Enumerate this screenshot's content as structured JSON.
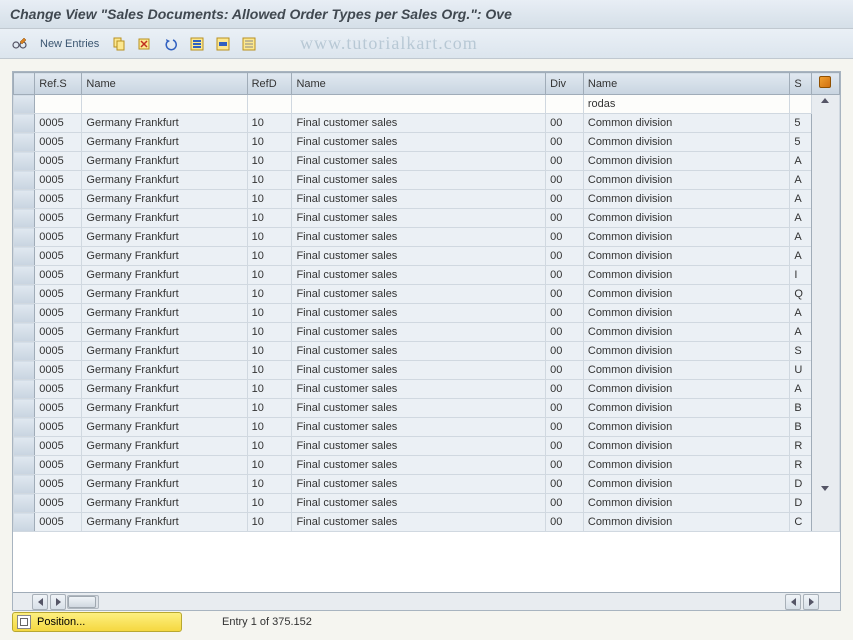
{
  "title": "Change View \"Sales Documents: Allowed Order Types per Sales Org.\": Ove",
  "watermark": "www.tutorialkart.com",
  "toolbar": {
    "new_entries": "New Entries"
  },
  "columns": {
    "refs": "Ref.S",
    "name1": "Name",
    "refd": "RefD",
    "name2": "Name",
    "div": "Div",
    "name3": "Name",
    "s": "S"
  },
  "rows": [
    {
      "refs": "",
      "name1": "",
      "refd": "",
      "name2": "",
      "div": "",
      "name3": "rodas",
      "s": ""
    },
    {
      "refs": "0005",
      "name1": "Germany Frankfurt",
      "refd": "10",
      "name2": "Final customer sales",
      "div": "00",
      "name3": "Common division",
      "s": "5"
    },
    {
      "refs": "0005",
      "name1": "Germany Frankfurt",
      "refd": "10",
      "name2": "Final customer sales",
      "div": "00",
      "name3": "Common division",
      "s": "5"
    },
    {
      "refs": "0005",
      "name1": "Germany Frankfurt",
      "refd": "10",
      "name2": "Final customer sales",
      "div": "00",
      "name3": "Common division",
      "s": "A"
    },
    {
      "refs": "0005",
      "name1": "Germany Frankfurt",
      "refd": "10",
      "name2": "Final customer sales",
      "div": "00",
      "name3": "Common division",
      "s": "A"
    },
    {
      "refs": "0005",
      "name1": "Germany Frankfurt",
      "refd": "10",
      "name2": "Final customer sales",
      "div": "00",
      "name3": "Common division",
      "s": "A"
    },
    {
      "refs": "0005",
      "name1": "Germany Frankfurt",
      "refd": "10",
      "name2": "Final customer sales",
      "div": "00",
      "name3": "Common division",
      "s": "A"
    },
    {
      "refs": "0005",
      "name1": "Germany Frankfurt",
      "refd": "10",
      "name2": "Final customer sales",
      "div": "00",
      "name3": "Common division",
      "s": "A"
    },
    {
      "refs": "0005",
      "name1": "Germany Frankfurt",
      "refd": "10",
      "name2": "Final customer sales",
      "div": "00",
      "name3": "Common division",
      "s": "A"
    },
    {
      "refs": "0005",
      "name1": "Germany Frankfurt",
      "refd": "10",
      "name2": "Final customer sales",
      "div": "00",
      "name3": "Common division",
      "s": "I"
    },
    {
      "refs": "0005",
      "name1": "Germany Frankfurt",
      "refd": "10",
      "name2": "Final customer sales",
      "div": "00",
      "name3": "Common division",
      "s": "Q"
    },
    {
      "refs": "0005",
      "name1": "Germany Frankfurt",
      "refd": "10",
      "name2": "Final customer sales",
      "div": "00",
      "name3": "Common division",
      "s": "A"
    },
    {
      "refs": "0005",
      "name1": "Germany Frankfurt",
      "refd": "10",
      "name2": "Final customer sales",
      "div": "00",
      "name3": "Common division",
      "s": "A"
    },
    {
      "refs": "0005",
      "name1": "Germany Frankfurt",
      "refd": "10",
      "name2": "Final customer sales",
      "div": "00",
      "name3": "Common division",
      "s": "S"
    },
    {
      "refs": "0005",
      "name1": "Germany Frankfurt",
      "refd": "10",
      "name2": "Final customer sales",
      "div": "00",
      "name3": "Common division",
      "s": "U"
    },
    {
      "refs": "0005",
      "name1": "Germany Frankfurt",
      "refd": "10",
      "name2": "Final customer sales",
      "div": "00",
      "name3": "Common division",
      "s": "A"
    },
    {
      "refs": "0005",
      "name1": "Germany Frankfurt",
      "refd": "10",
      "name2": "Final customer sales",
      "div": "00",
      "name3": "Common division",
      "s": "B"
    },
    {
      "refs": "0005",
      "name1": "Germany Frankfurt",
      "refd": "10",
      "name2": "Final customer sales",
      "div": "00",
      "name3": "Common division",
      "s": "B"
    },
    {
      "refs": "0005",
      "name1": "Germany Frankfurt",
      "refd": "10",
      "name2": "Final customer sales",
      "div": "00",
      "name3": "Common division",
      "s": "R"
    },
    {
      "refs": "0005",
      "name1": "Germany Frankfurt",
      "refd": "10",
      "name2": "Final customer sales",
      "div": "00",
      "name3": "Common division",
      "s": "R"
    },
    {
      "refs": "0005",
      "name1": "Germany Frankfurt",
      "refd": "10",
      "name2": "Final customer sales",
      "div": "00",
      "name3": "Common division",
      "s": "D"
    },
    {
      "refs": "0005",
      "name1": "Germany Frankfurt",
      "refd": "10",
      "name2": "Final customer sales",
      "div": "00",
      "name3": "Common division",
      "s": "D"
    },
    {
      "refs": "0005",
      "name1": "Germany Frankfurt",
      "refd": "10",
      "name2": "Final customer sales",
      "div": "00",
      "name3": "Common division",
      "s": "C"
    }
  ],
  "footer": {
    "position_label": "Position...",
    "entry_text": "Entry 1 of 375.152"
  }
}
